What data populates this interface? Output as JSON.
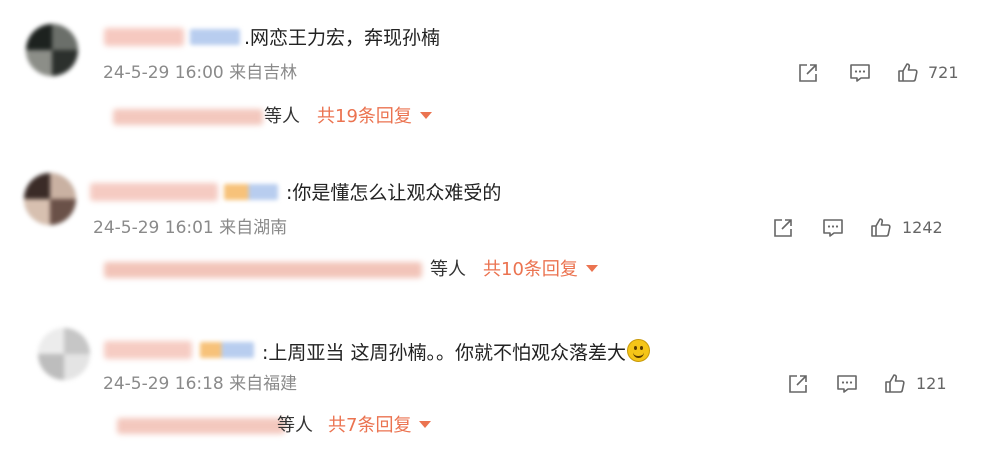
{
  "comments": [
    {
      "text": ".网恋王力宏，奔现孙楠",
      "meta": "24-5-29 16:00 来自吉林",
      "likes": "721",
      "etc": "等人",
      "reply": "共19条回复",
      "has_emoji": false,
      "icons": [
        "share-icon",
        "comment-icon",
        "like-icon"
      ]
    },
    {
      "text": ":你是懂怎么让观众难受的",
      "meta": "24-5-29 16:01 来自湖南",
      "likes": "1242",
      "etc": "等人",
      "reply": "共10条回复",
      "has_emoji": false,
      "icons": [
        "share-icon",
        "comment-icon",
        "like-icon"
      ]
    },
    {
      "text": ":上周亚当 这周孙楠。。你就不怕观众落差大",
      "meta": "24-5-29 16:18 来自福建",
      "likes": "121",
      "etc": "等人",
      "reply": "共7条回复",
      "has_emoji": true,
      "icons": [
        "share-icon",
        "comment-icon",
        "like-icon"
      ]
    }
  ],
  "colors": {
    "reply_link": "#eb7350",
    "meta_text": "#8a8a8a",
    "icon_stroke": "#666666"
  }
}
